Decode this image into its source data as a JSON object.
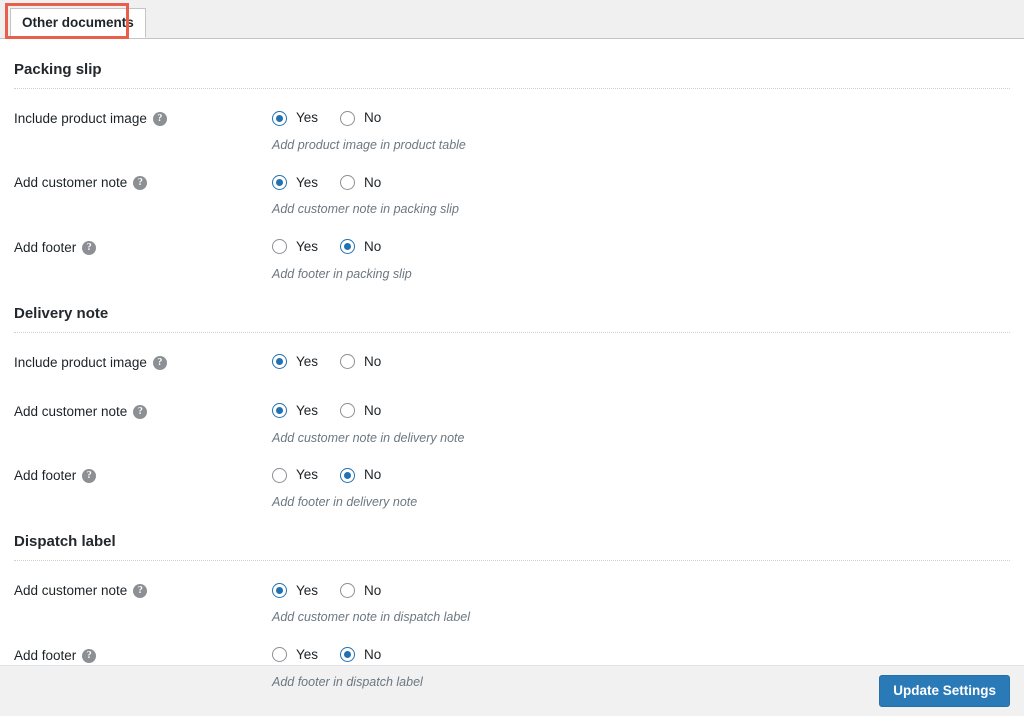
{
  "tabs": [
    {
      "label": "Other documents",
      "active": true,
      "highlighted": true
    }
  ],
  "highlight_color": "#e8604c",
  "accent_color": "#2271b1",
  "button_color": "#2b7ab8",
  "sections": [
    {
      "title": "Packing slip",
      "fields": [
        {
          "label": "Include product image",
          "help": "?",
          "options": [
            {
              "label": "Yes",
              "selected": true
            },
            {
              "label": "No",
              "selected": false
            }
          ],
          "description": "Add product image in product table"
        },
        {
          "label": "Add customer note",
          "help": "?",
          "options": [
            {
              "label": "Yes",
              "selected": true
            },
            {
              "label": "No",
              "selected": false
            }
          ],
          "description": "Add customer note in packing slip"
        },
        {
          "label": "Add footer",
          "help": "?",
          "options": [
            {
              "label": "Yes",
              "selected": false
            },
            {
              "label": "No",
              "selected": true
            }
          ],
          "description": "Add footer in packing slip"
        }
      ]
    },
    {
      "title": "Delivery note",
      "fields": [
        {
          "label": "Include product image",
          "help": "?",
          "options": [
            {
              "label": "Yes",
              "selected": true
            },
            {
              "label": "No",
              "selected": false
            }
          ],
          "description": ""
        },
        {
          "label": "Add customer note",
          "help": "?",
          "options": [
            {
              "label": "Yes",
              "selected": true
            },
            {
              "label": "No",
              "selected": false
            }
          ],
          "description": "Add customer note in delivery note"
        },
        {
          "label": "Add footer",
          "help": "?",
          "options": [
            {
              "label": "Yes",
              "selected": false
            },
            {
              "label": "No",
              "selected": true
            }
          ],
          "description": "Add footer in delivery note"
        }
      ]
    },
    {
      "title": "Dispatch label",
      "fields": [
        {
          "label": "Add customer note",
          "help": "?",
          "options": [
            {
              "label": "Yes",
              "selected": true
            },
            {
              "label": "No",
              "selected": false
            }
          ],
          "description": "Add customer note in dispatch label"
        },
        {
          "label": "Add footer",
          "help": "?",
          "options": [
            {
              "label": "Yes",
              "selected": false
            },
            {
              "label": "No",
              "selected": true
            }
          ],
          "description": "Add footer in dispatch label"
        }
      ]
    }
  ],
  "footer": {
    "submit_label": "Update Settings"
  }
}
